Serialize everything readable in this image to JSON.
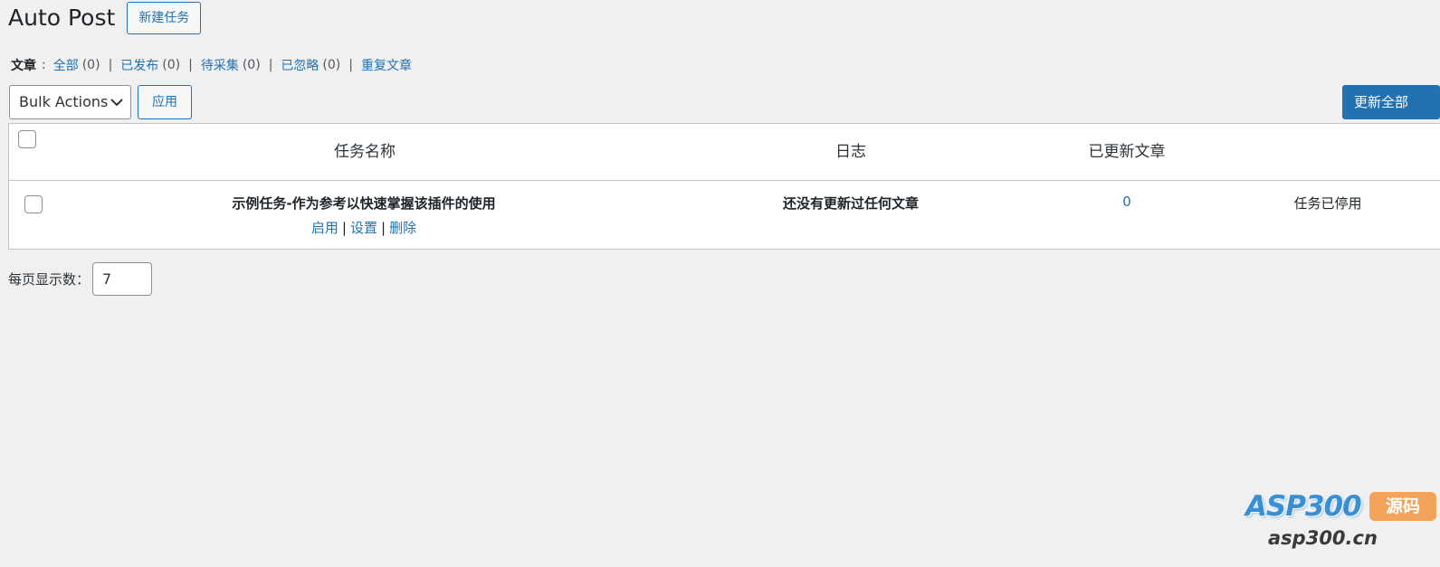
{
  "header": {
    "title": "Auto Post",
    "new_task_label": "新建任务"
  },
  "filters": {
    "label": "文章",
    "colon": ":",
    "separator": "|",
    "items": [
      {
        "label": "全部",
        "count": "(0)"
      },
      {
        "label": "已发布",
        "count": "(0)"
      },
      {
        "label": "待采集",
        "count": "(0)"
      },
      {
        "label": "已忽略",
        "count": "(0)"
      },
      {
        "label": "重复文章",
        "count": ""
      }
    ]
  },
  "toolbar": {
    "bulk_actions_selected": "Bulk Actions",
    "apply_label": "应用",
    "update_all_label": "更新全部"
  },
  "table": {
    "columns": [
      "任务名称",
      "日志",
      "已更新文章"
    ],
    "rows": [
      {
        "name": "示例任务-作为参考以快速掌握该插件的使用",
        "actions": [
          "启用",
          "设置",
          "删除"
        ],
        "log": "还没有更新过任何文章",
        "updated_count": "0",
        "status": "任务已停用"
      }
    ],
    "action_separator": "|"
  },
  "pagination": {
    "per_page_label": "每页显示数：",
    "per_page_value": "7"
  },
  "watermark": {
    "brand": "ASP300",
    "badge": "源码",
    "url": "asp300.cn"
  },
  "colors": {
    "accent": "#2271b1",
    "background": "#f0f0f1",
    "watermark_blue": "#3a8fd3",
    "watermark_badge": "#f4a35a"
  }
}
